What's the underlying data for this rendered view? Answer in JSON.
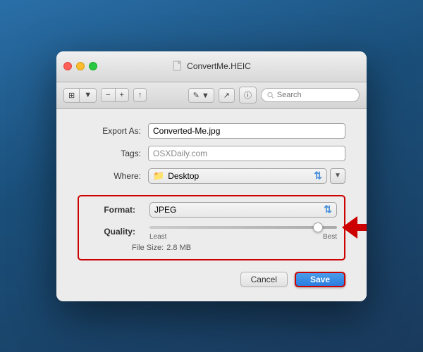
{
  "window": {
    "title": "ConvertMe.HEIC",
    "traffic_lights": {
      "close": "close",
      "minimize": "minimize",
      "maximize": "maximize"
    }
  },
  "toolbar": {
    "view_toggle": "⊞",
    "zoom_out": "−",
    "zoom_in": "+",
    "action": "↑",
    "edit_icon": "✎",
    "share_icon": "↗",
    "info_icon": "ℹ",
    "search_placeholder": "Search"
  },
  "form": {
    "export_as_label": "Export As:",
    "export_as_value": "Converted-Me.jpg",
    "tags_label": "Tags:",
    "tags_value": "OSXDaily.com",
    "where_label": "Where:",
    "where_folder_icon": "📁",
    "where_value": "Desktop",
    "format_label": "Format:",
    "format_value": "JPEG",
    "quality_label": "Quality:",
    "quality_least": "Least",
    "quality_best": "Best",
    "file_size_label": "File Size:",
    "file_size_value": "2.8 MB"
  },
  "buttons": {
    "cancel_label": "Cancel",
    "save_label": "Save"
  }
}
